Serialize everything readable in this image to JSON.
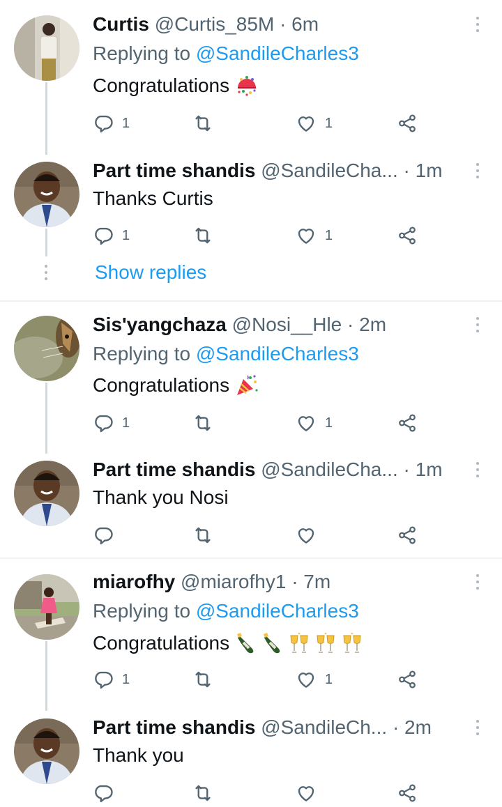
{
  "tweets": [
    {
      "name": "Curtis",
      "handle": "@Curtis_85M",
      "dot": "·",
      "time": "6m",
      "replying_prefix": "Replying to",
      "replying_to": "@SandileCharles3",
      "text": "Congratulations",
      "emojis": [
        "confetti-ball"
      ],
      "reply_count": "1",
      "like_count": "1"
    },
    {
      "name": "Part time shandis",
      "handle": "@SandileCha...",
      "dot": "·",
      "time": "1m",
      "text": "Thanks Curtis",
      "reply_count": "1",
      "like_count": "1",
      "show_replies": "Show replies"
    },
    {
      "name": "Sis'yangchaza",
      "handle": "@Nosi__Hle",
      "dot": "·",
      "time": "2m",
      "replying_prefix": "Replying to",
      "replying_to": "@SandileCharles3",
      "text": "Congratulations",
      "emojis": [
        "party-popper"
      ],
      "reply_count": "1",
      "like_count": "1"
    },
    {
      "name": "Part time shandis",
      "handle": "@SandileCha...",
      "dot": "·",
      "time": "1m",
      "text": "Thank you Nosi",
      "reply_count": "",
      "like_count": ""
    },
    {
      "name": "miarofhy",
      "handle": "@miarofhy1",
      "dot": "·",
      "time": "7m",
      "replying_prefix": "Replying to",
      "replying_to": "@SandileCharles3",
      "text": "Congratulations",
      "emojis": [
        "champagne-bottle",
        "champagne-bottle",
        "clinking-glasses",
        "clinking-glasses",
        "clinking-glasses"
      ],
      "reply_count": "1",
      "like_count": "1"
    },
    {
      "name": "Part time shandis",
      "handle": "@SandileCh...",
      "dot": "·",
      "time": "2m",
      "text": "Thank you",
      "reply_count": "",
      "like_count": ""
    }
  ],
  "icons": {
    "reply": "reply-icon",
    "retweet": "retweet-icon",
    "like": "heart-icon",
    "share": "share-icon",
    "more": "more-vertical-icon"
  },
  "colors": {
    "link": "#1d9bf0",
    "secondary_text": "#536471",
    "thread_line": "#cfd9de"
  }
}
